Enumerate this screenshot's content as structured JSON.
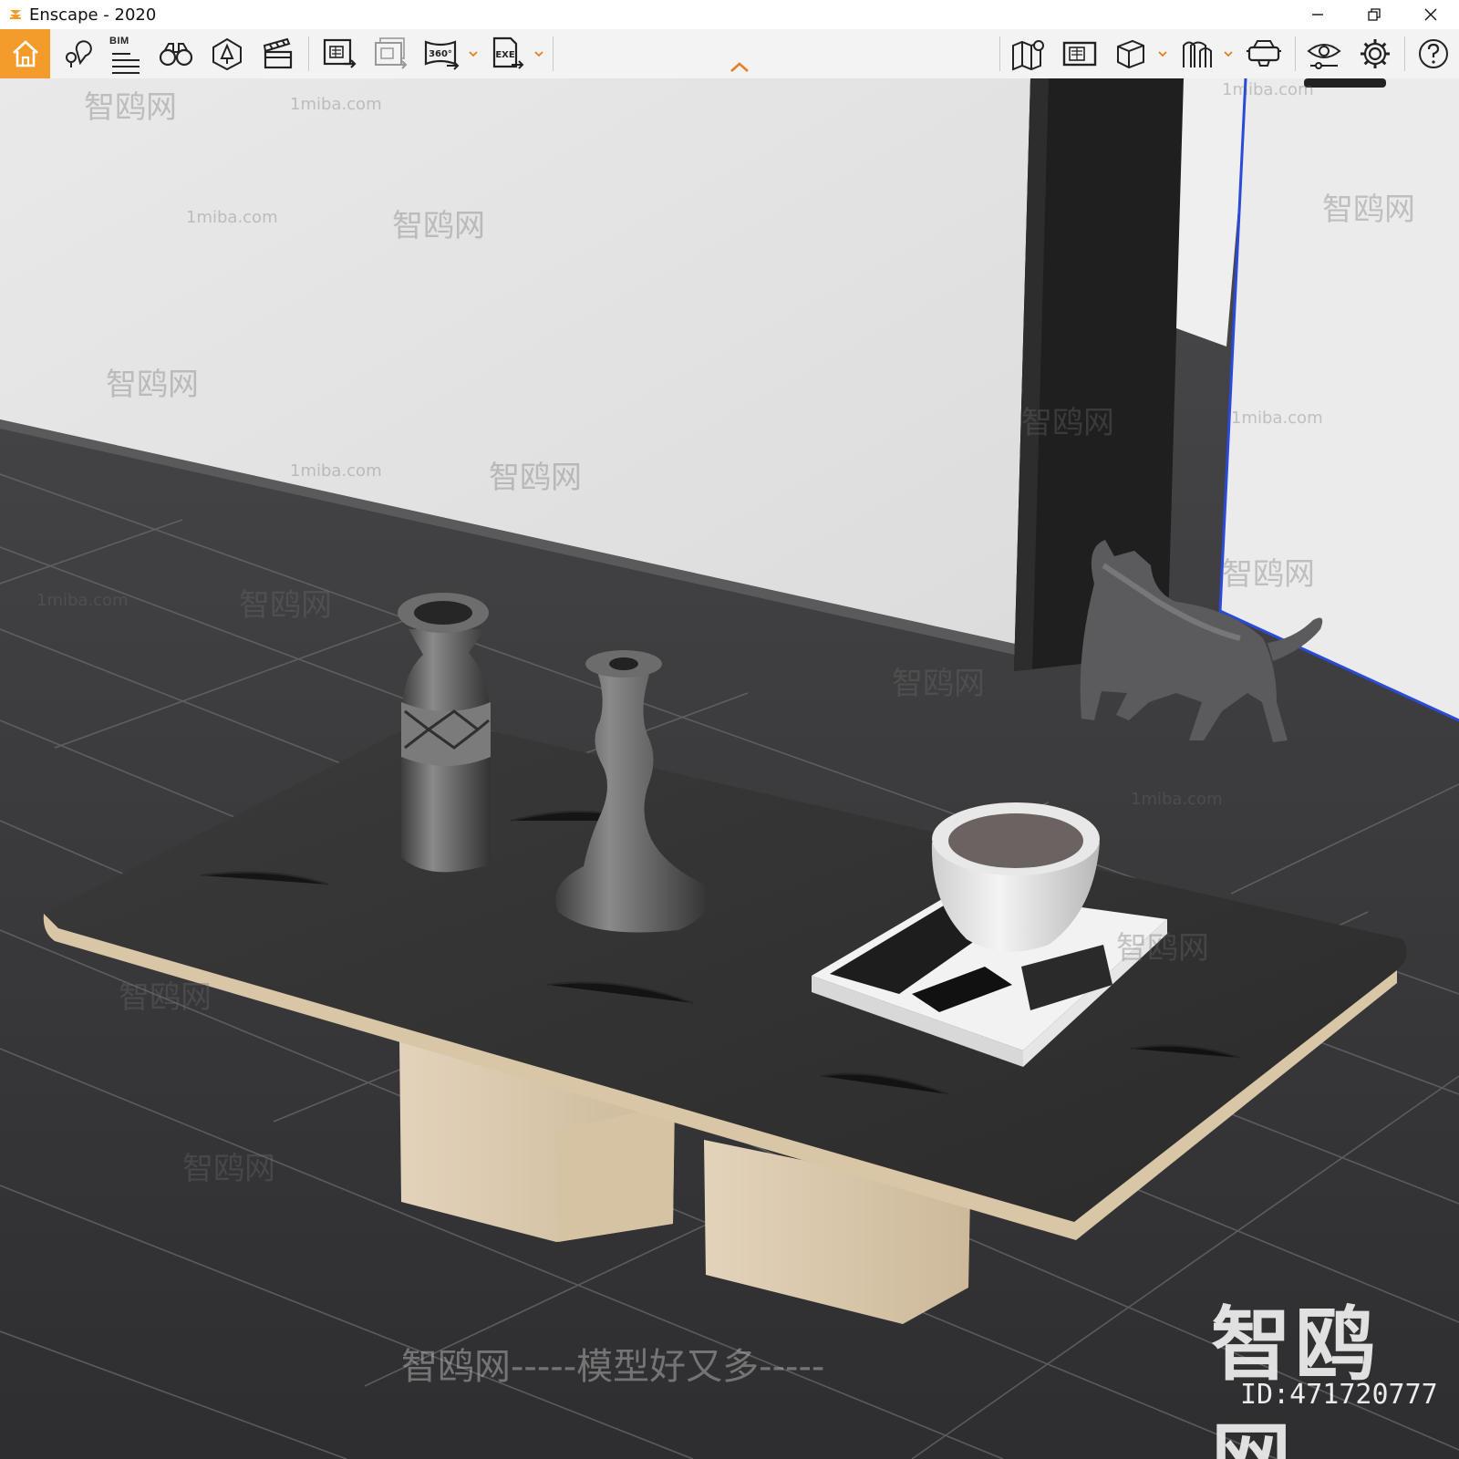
{
  "window": {
    "title": "Enscape - 2020",
    "controls": [
      "minimize",
      "restore",
      "close"
    ]
  },
  "toolbar": {
    "bim_label": "BIM",
    "tools_left": [
      {
        "name": "home",
        "icon": "home-icon",
        "active": true
      },
      {
        "name": "views",
        "icon": "location-pin-icon"
      },
      {
        "name": "bim",
        "icon": "bim-list-icon"
      },
      {
        "name": "binoculars",
        "icon": "binoculars-icon"
      },
      {
        "name": "assets",
        "icon": "asset-library-icon"
      },
      {
        "name": "video",
        "icon": "clapperboard-icon"
      },
      {
        "name": "render-image",
        "icon": "render-image-icon"
      },
      {
        "name": "batch-render",
        "icon": "batch-render-icon"
      },
      {
        "name": "panorama",
        "icon": "panorama-360-icon",
        "label": "360°"
      },
      {
        "name": "export-exe",
        "icon": "export-exe-icon",
        "label": "EXE"
      }
    ],
    "tools_right": [
      {
        "name": "map",
        "icon": "map-pin-icon"
      },
      {
        "name": "capture",
        "icon": "capture-screen-icon"
      },
      {
        "name": "section-box",
        "icon": "cube-icon"
      },
      {
        "name": "collaborative-annotation",
        "icon": "annotation-icon"
      },
      {
        "name": "vr",
        "icon": "vr-headset-icon"
      },
      {
        "name": "visual-settings",
        "icon": "eye-settings-icon"
      },
      {
        "name": "settings",
        "icon": "gear-icon"
      },
      {
        "name": "help",
        "icon": "help-icon"
      }
    ],
    "accent_color": "#f39c2b"
  },
  "watermarks": {
    "site": "1miba.com",
    "brand": "智鸥网",
    "slogan": "智鸥网-----模型好又多-----",
    "big_brand": "智鸥网",
    "id_text": "ID:471720777"
  }
}
